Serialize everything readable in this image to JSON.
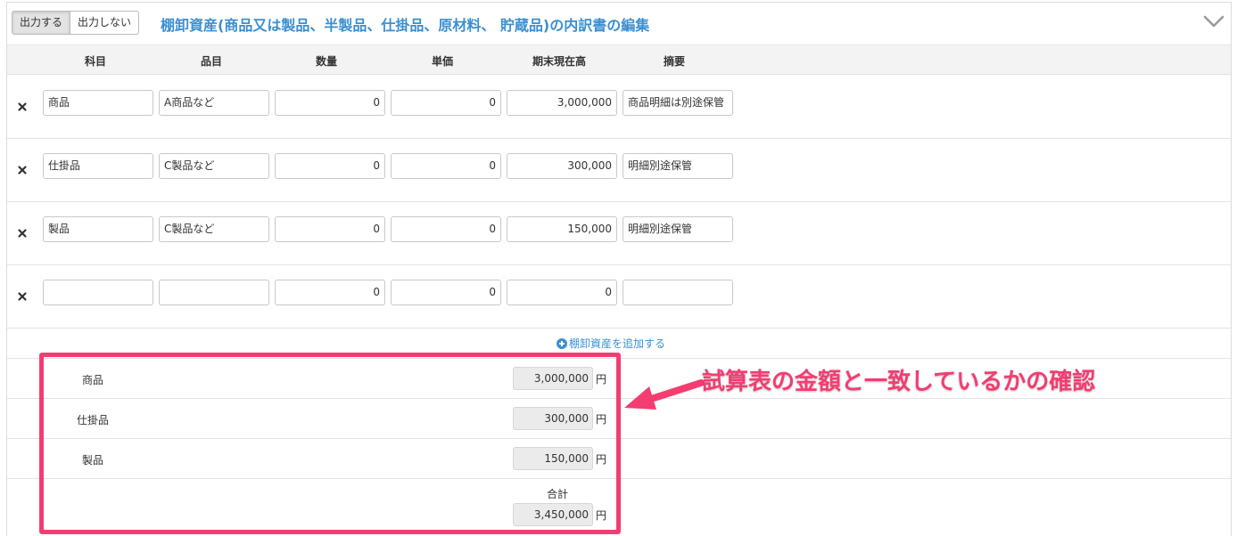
{
  "header": {
    "toggle_output": "出力する",
    "toggle_no_output": "出力しない",
    "title": "棚卸資産(商品又は製品、半製品、仕掛品、原材料、 貯蔵品)の内訳書の編集"
  },
  "columns": [
    "科目",
    "品目",
    "数量",
    "単価",
    "期末現在高",
    "摘要"
  ],
  "rows": [
    {
      "kamoku": "商品",
      "himoku": "A商品など",
      "suryo": "0",
      "tanka": "0",
      "kimatsu": "3,000,000",
      "tekiyo": "商品明細は別途保管"
    },
    {
      "kamoku": "仕掛品",
      "himoku": "C製品など",
      "suryo": "0",
      "tanka": "0",
      "kimatsu": "300,000",
      "tekiyo": "明細別途保管"
    },
    {
      "kamoku": "製品",
      "himoku": "C製品など",
      "suryo": "0",
      "tanka": "0",
      "kimatsu": "150,000",
      "tekiyo": "明細別途保管"
    },
    {
      "kamoku": "",
      "himoku": "",
      "suryo": "0",
      "tanka": "0",
      "kimatsu": "0",
      "tekiyo": ""
    }
  ],
  "add_link": "棚卸資産を追加する",
  "summary": [
    {
      "label": "商品",
      "value": "3,000,000",
      "unit": "円"
    },
    {
      "label": "仕掛品",
      "value": "300,000",
      "unit": "円"
    },
    {
      "label": "製品",
      "value": "150,000",
      "unit": "円"
    }
  ],
  "total": {
    "label": "合計",
    "value": "3,450,000",
    "unit": "円"
  },
  "annotation": {
    "text": "試算表の金額と一致しているかの確認",
    "color": "#f33d72"
  },
  "colors": {
    "accent": "#3b8fd1",
    "highlight": "#f33d72"
  },
  "icons": {
    "delete": "close-icon",
    "collapse": "chevron-down-icon",
    "add": "plus-circle-icon"
  }
}
